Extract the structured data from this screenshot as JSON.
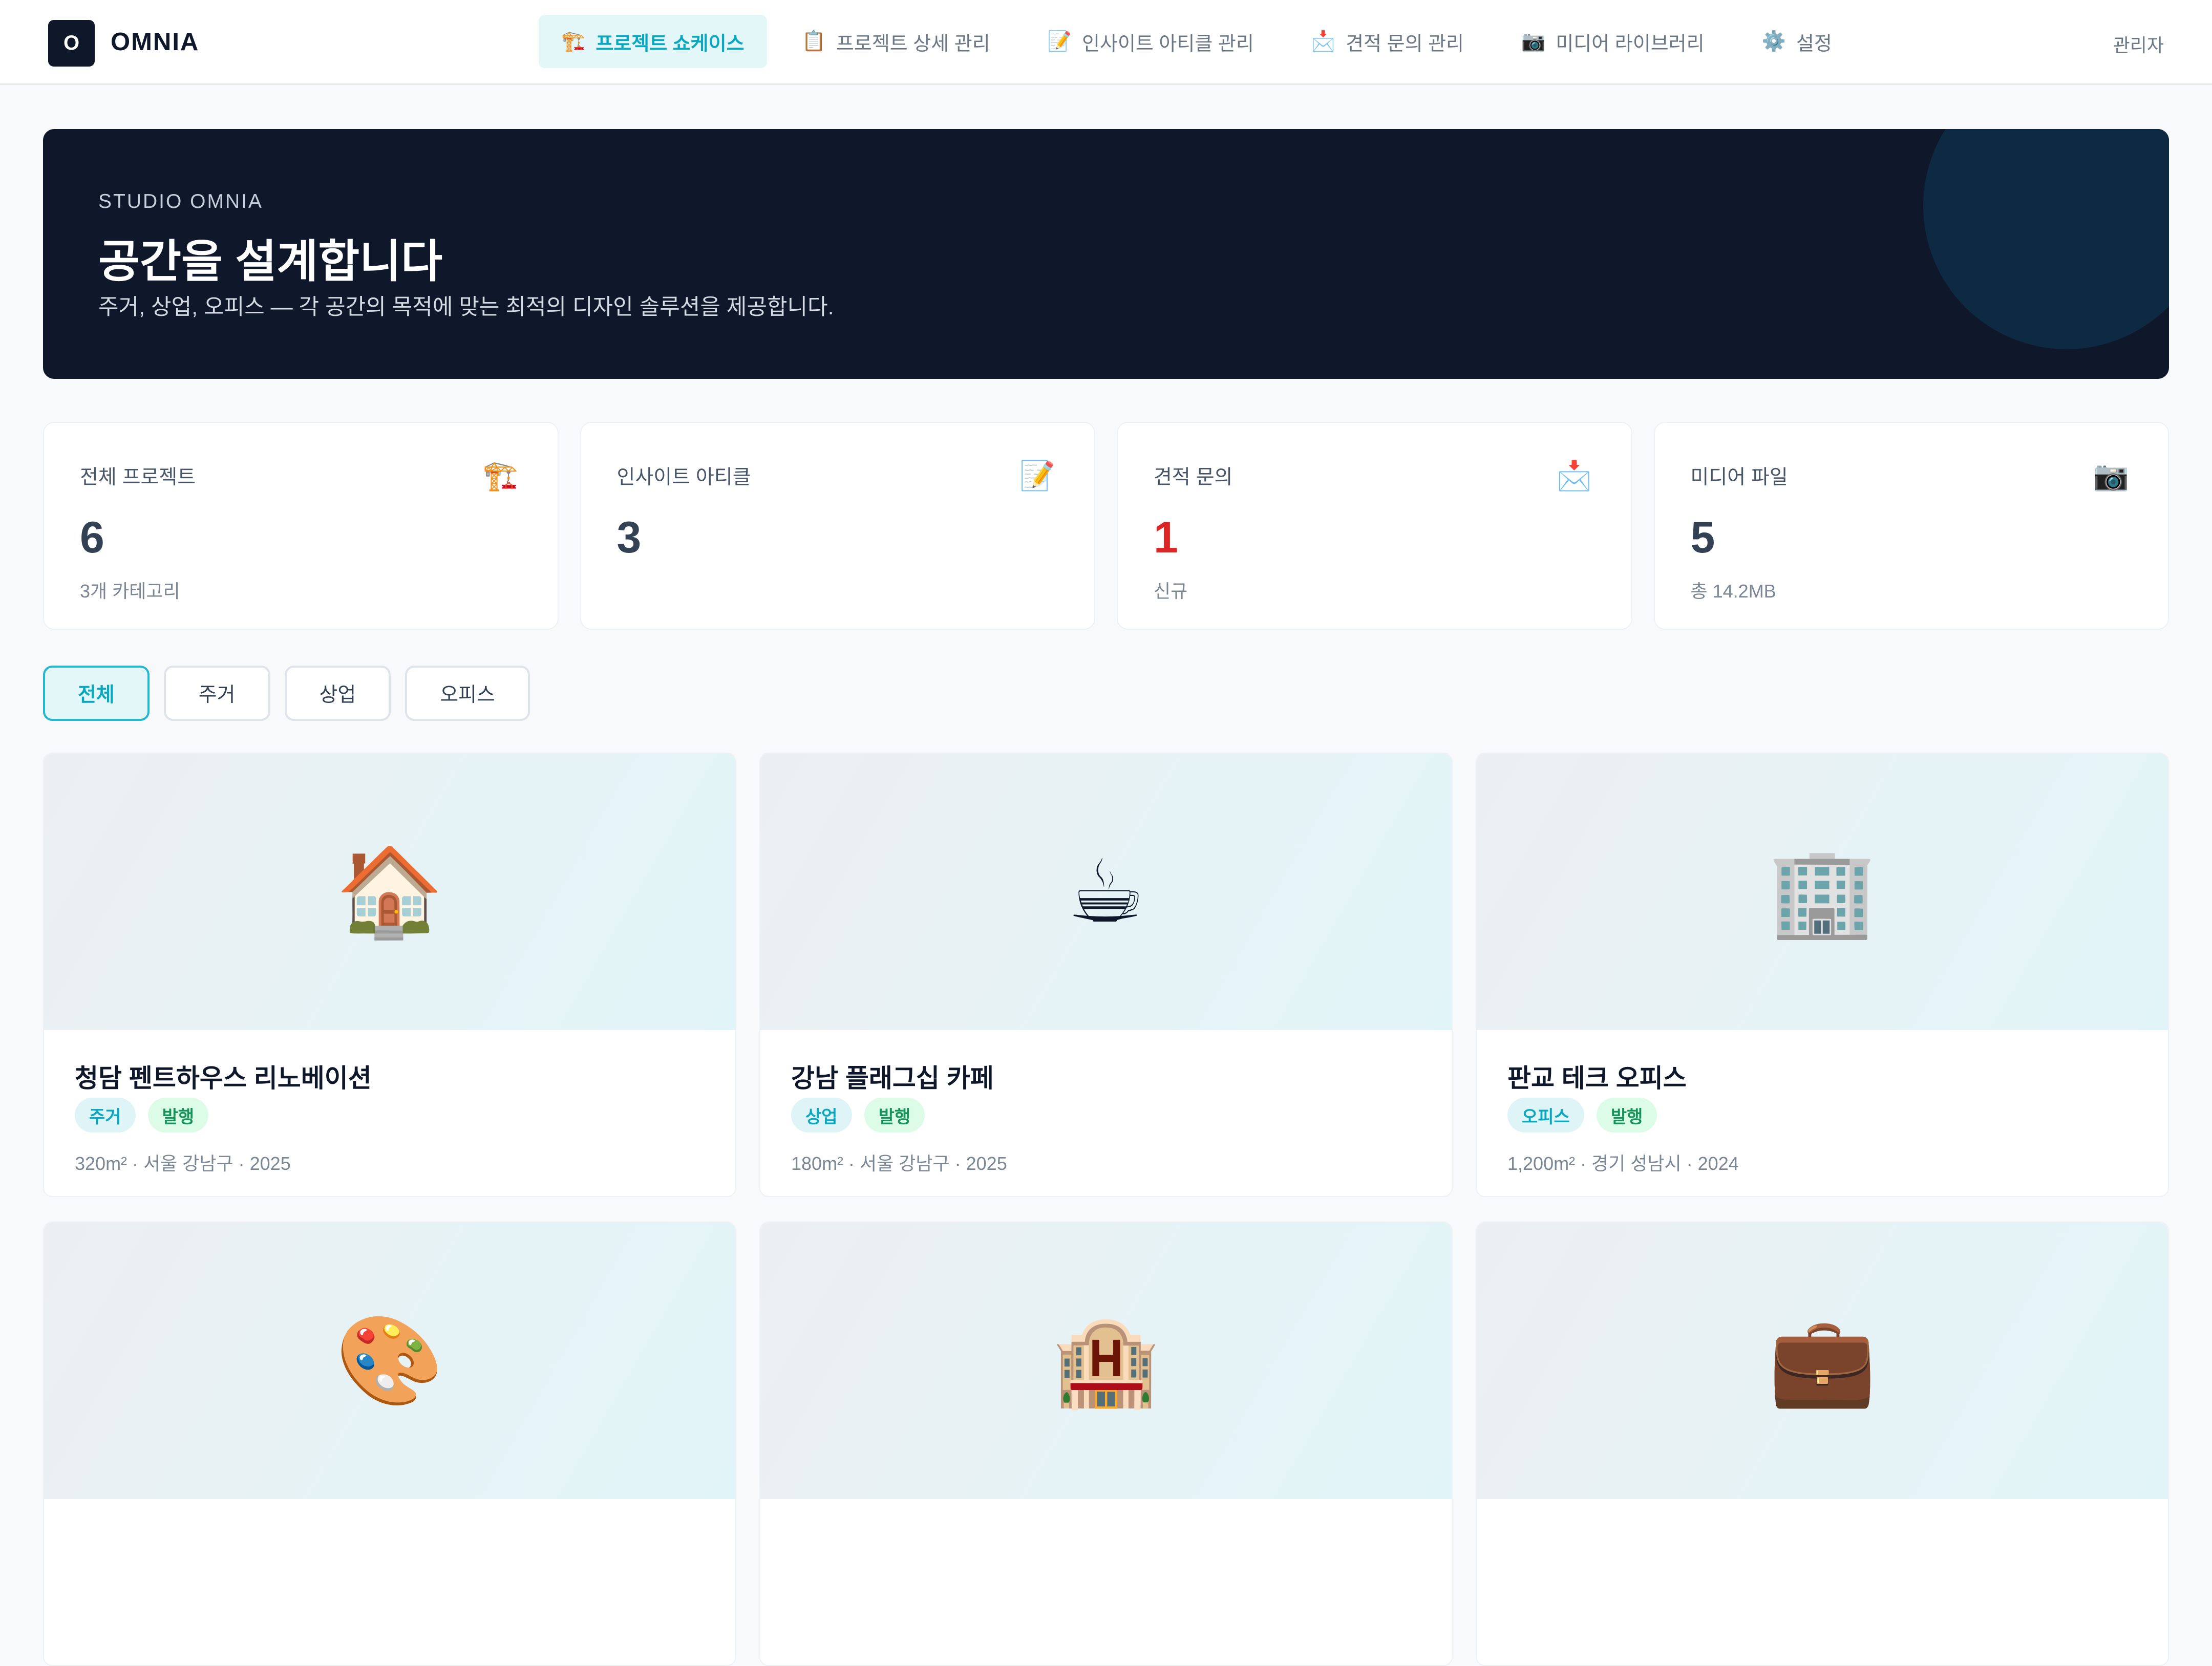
{
  "header": {
    "logo_mark": "O",
    "brand": "OMNIA",
    "nav": [
      {
        "icon": "🏗️",
        "label": "프로젝트 쇼케이스",
        "active": true
      },
      {
        "icon": "📋",
        "label": "프로젝트 상세 관리",
        "active": false
      },
      {
        "icon": "📝",
        "label": "인사이트 아티클 관리",
        "active": false
      },
      {
        "icon": "📩",
        "label": "견적 문의 관리",
        "active": false
      },
      {
        "icon": "📷",
        "label": "미디어 라이브러리",
        "active": false
      },
      {
        "icon": "⚙️",
        "label": "설정",
        "active": false
      }
    ],
    "user": "관리자"
  },
  "hero": {
    "eyebrow": "STUDIO OMNIA",
    "title": "공간을 설계합니다",
    "subtitle": "주거, 상업, 오피스 — 각 공간의 목적에 맞는 최적의 디자인 솔루션을 제공합니다."
  },
  "stats": [
    {
      "label": "전체 프로젝트",
      "icon": "🏗️",
      "value": "6",
      "note": "3개 카테고리"
    },
    {
      "label": "인사이트 아티클",
      "icon": "📝",
      "value": "3",
      "note": ""
    },
    {
      "label": "견적 문의",
      "icon": "📩",
      "value": "1",
      "note": "신규"
    },
    {
      "label": "미디어 파일",
      "icon": "📷",
      "value": "5",
      "note": "총 14.2MB"
    }
  ],
  "filters": [
    {
      "label": "전체",
      "active": true
    },
    {
      "label": "주거",
      "active": false
    },
    {
      "label": "상업",
      "active": false
    },
    {
      "label": "오피스",
      "active": false
    }
  ],
  "projects": [
    {
      "emoji": "🏠",
      "title": "청담 펜트하우스 리노베이션",
      "category": "주거",
      "status": "발행",
      "meta": "320m² · 서울 강남구 · 2025"
    },
    {
      "emoji": "☕",
      "title": "강남 플래그십 카페",
      "category": "상업",
      "status": "발행",
      "meta": "180m² · 서울 강남구 · 2025"
    },
    {
      "emoji": "🏢",
      "title": "판교 테크 오피스",
      "category": "오피스",
      "status": "발행",
      "meta": "1,200m² · 경기 성남시 · 2024"
    },
    {
      "emoji": "🎨",
      "title": "",
      "category": "",
      "status": "",
      "meta": ""
    },
    {
      "emoji": "🏨",
      "title": "",
      "category": "",
      "status": "",
      "meta": ""
    },
    {
      "emoji": "💼",
      "title": "",
      "category": "",
      "status": "",
      "meta": ""
    }
  ],
  "colors": {
    "accent": "#0aa7c1",
    "navy": "#0f172a",
    "danger": "#dc2626",
    "published": "#15935a"
  }
}
